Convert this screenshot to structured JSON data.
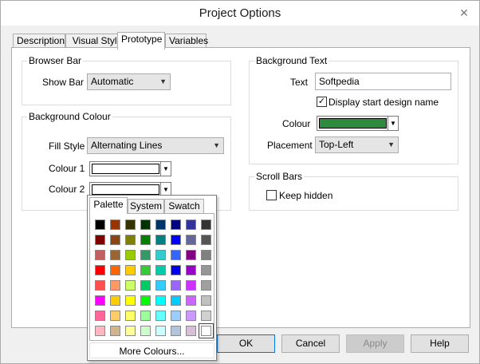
{
  "window": {
    "title": "Project Options"
  },
  "tabs": [
    {
      "label": "Description"
    },
    {
      "label": "Visual Style"
    },
    {
      "label": "Prototype"
    },
    {
      "label": "Variables"
    }
  ],
  "browser_bar": {
    "title": "Browser Bar",
    "show_bar_label": "Show Bar",
    "show_bar_value": "Automatic"
  },
  "background_colour": {
    "title": "Background Colour",
    "fill_style_label": "Fill Style",
    "fill_style_value": "Alternating Lines",
    "colour1_label": "Colour 1",
    "colour2_label": "Colour 2",
    "colour1": "#ffffff",
    "colour2": "#ffffff"
  },
  "background_text": {
    "title": "Background Text",
    "text_label": "Text",
    "text_value": "Softpedia",
    "display_checkbox_label": "Display start design name",
    "display_checked": true,
    "check_mark": "✓",
    "colour_label": "Colour",
    "colour": "#2e8b3d",
    "placement_label": "Placement",
    "placement_value": "Top-Left"
  },
  "scroll_bars": {
    "title": "Scroll Bars",
    "keep_hidden_label": "Keep hidden",
    "keep_hidden_checked": false
  },
  "buttons": {
    "ok": "OK",
    "cancel": "Cancel",
    "apply": "Apply",
    "help": "Help"
  },
  "colour_popup": {
    "tabs": [
      {
        "label": "Palette"
      },
      {
        "label": "System"
      },
      {
        "label": "Swatch"
      }
    ],
    "more_label": "More Colours...",
    "palette": [
      [
        "#000000",
        "#993300",
        "#333300",
        "#003300",
        "#003366",
        "#000080",
        "#333399",
        "#333333"
      ],
      [
        "#800000",
        "#8b4513",
        "#808000",
        "#008000",
        "#008080",
        "#0000ff",
        "#666699",
        "#555555"
      ],
      [
        "#c06060",
        "#996633",
        "#99cc00",
        "#339966",
        "#33cccc",
        "#3366ff",
        "#800080",
        "#808080"
      ],
      [
        "#ff0000",
        "#ff6600",
        "#ffcc00",
        "#33cc33",
        "#00ccaa",
        "#0000ee",
        "#9900cc",
        "#969696"
      ],
      [
        "#ff5050",
        "#ff9966",
        "#ccff66",
        "#00cc66",
        "#33ccff",
        "#9966ff",
        "#cc33ff",
        "#a0a0a0"
      ],
      [
        "#ff00ff",
        "#ffcc00",
        "#ffff00",
        "#00ff00",
        "#00ffff",
        "#00ccff",
        "#cc66ff",
        "#c0c0c0"
      ],
      [
        "#ff6699",
        "#ffcc66",
        "#ffff66",
        "#99ff99",
        "#66ffff",
        "#99ccff",
        "#cc99ff",
        "#d0d0d0"
      ],
      [
        "#ffb6c1",
        "#d2b48c",
        "#ffff99",
        "#ccffcc",
        "#ccffff",
        "#b0c4de",
        "#d8bfd8",
        "#ffffff"
      ]
    ]
  }
}
